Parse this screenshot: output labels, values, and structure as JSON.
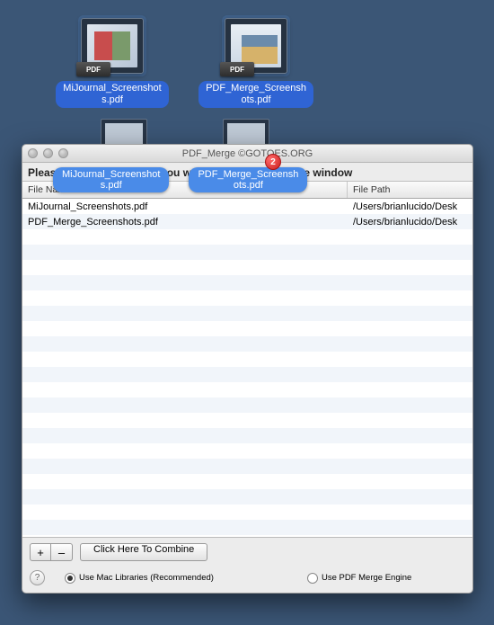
{
  "desktop": {
    "files": [
      {
        "label": "MiJournal_Screenshot\ns.pdf",
        "badge": "PDF"
      },
      {
        "label": "PDF_Merge_Screensh\nots.pdf",
        "badge": "PDF"
      }
    ]
  },
  "drag": {
    "badge_count": "2",
    "labels": [
      "MiJournal_Screenshot\ns.pdf",
      "PDF_Merge_Screensh\nots.pdf"
    ],
    "icon_badge": "PDF"
  },
  "window": {
    "title": "PDF_Merge ©GOTOES.ORG",
    "instruction": "Please Drag the PDF files you want to combine into the window",
    "columns": {
      "c1": "File Name to Combine into PDF",
      "c2": "File Path"
    },
    "rows": [
      {
        "name": "MiJournal_Screenshots.pdf",
        "path": "/Users/brianlucido/Desk"
      },
      {
        "name": "PDF_Merge_Screenshots.pdf",
        "path": "/Users/brianlucido/Desk"
      }
    ],
    "buttons": {
      "add": "+",
      "remove": "–",
      "combine": "Click Here To Combine"
    },
    "help": "?",
    "options": {
      "mac_libs": "Use Mac Libraries (Recommended)",
      "pdf_engine": "Use PDF Merge Engine"
    }
  }
}
